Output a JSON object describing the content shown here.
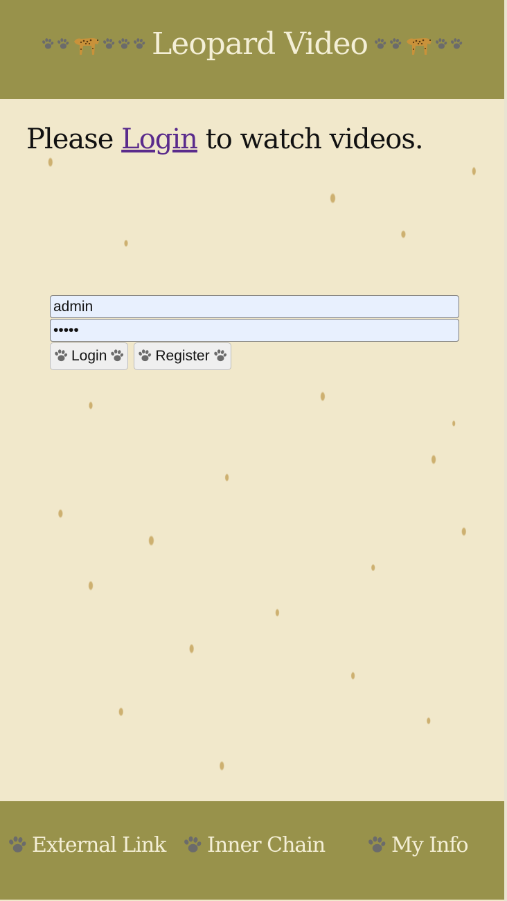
{
  "header": {
    "title": "Leopard Video"
  },
  "prompt": {
    "before": "Please ",
    "link": "Login",
    "after": " to watch videos."
  },
  "login": {
    "username_value": "admin",
    "password_value": "•••••",
    "login_label": "Login",
    "register_label": "Register"
  },
  "footer": {
    "links": [
      {
        "label": "External Link"
      },
      {
        "label": "Inner Chain"
      },
      {
        "label": "My Info"
      }
    ]
  },
  "colors": {
    "header_bg": "#98924b",
    "page_bg": "#f1e8cb",
    "link": "#5a2b8c",
    "header_text": "#f4efd6"
  },
  "icons": {
    "paw": "paw-icon",
    "leopard": "leopard-icon"
  }
}
